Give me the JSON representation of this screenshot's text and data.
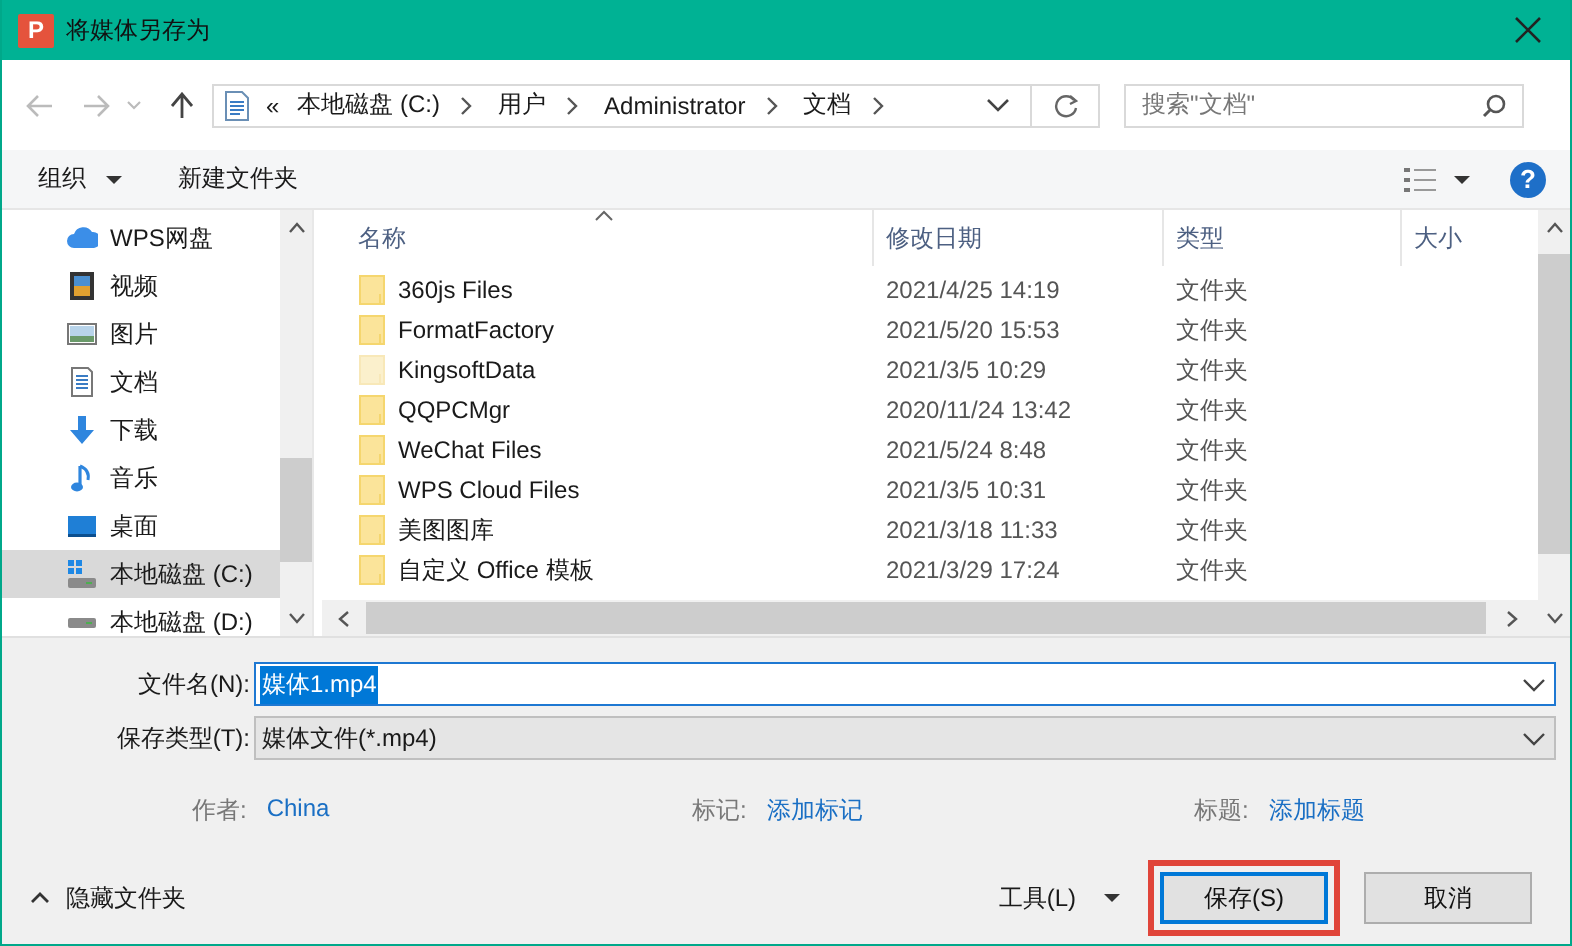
{
  "window": {
    "title": "将媒体另存为",
    "app_badge": "P"
  },
  "address_bar": {
    "prefix": "«",
    "path": [
      "本地磁盘 (C:)",
      "用户",
      "Administrator",
      "文档"
    ]
  },
  "search": {
    "placeholder": "搜索\"文档\""
  },
  "toolbar": {
    "organize": "组织",
    "new_folder": "新建文件夹",
    "help": "?"
  },
  "sidebar": {
    "items": [
      {
        "label": "WPS网盘",
        "kind": "cloud",
        "selected": false
      },
      {
        "label": "视频",
        "kind": "video",
        "selected": false
      },
      {
        "label": "图片",
        "kind": "picture",
        "selected": false
      },
      {
        "label": "文档",
        "kind": "document",
        "selected": false
      },
      {
        "label": "下载",
        "kind": "download",
        "selected": false
      },
      {
        "label": "音乐",
        "kind": "music",
        "selected": false
      },
      {
        "label": "桌面",
        "kind": "desktop",
        "selected": false
      },
      {
        "label": "本地磁盘 (C:)",
        "kind": "system-drive",
        "selected": true
      },
      {
        "label": "本地磁盘 (D:)",
        "kind": "drive",
        "selected": false
      }
    ]
  },
  "file_list": {
    "columns": [
      "名称",
      "修改日期",
      "类型",
      "大小"
    ],
    "rows": [
      {
        "name": "360js Files",
        "modified": "2021/4/25 14:19",
        "type": "文件夹",
        "hidden": false
      },
      {
        "name": "FormatFactory",
        "modified": "2021/5/20 15:53",
        "type": "文件夹",
        "hidden": false
      },
      {
        "name": "KingsoftData",
        "modified": "2021/3/5 10:29",
        "type": "文件夹",
        "hidden": true
      },
      {
        "name": "QQPCMgr",
        "modified": "2020/11/24 13:42",
        "type": "文件夹",
        "hidden": false
      },
      {
        "name": "WeChat Files",
        "modified": "2021/5/24 8:48",
        "type": "文件夹",
        "hidden": false
      },
      {
        "name": "WPS Cloud Files",
        "modified": "2021/3/5 10:31",
        "type": "文件夹",
        "hidden": false
      },
      {
        "name": "美图图库",
        "modified": "2021/3/18 11:33",
        "type": "文件夹",
        "hidden": false
      },
      {
        "name": "自定义 Office 模板",
        "modified": "2021/3/29 17:24",
        "type": "文件夹",
        "hidden": false
      }
    ]
  },
  "form": {
    "file_name": {
      "label": "文件名(N):",
      "value": "媒体1.mp4",
      "text_selected": true
    },
    "file_type": {
      "label": "保存类型(T):",
      "value": "媒体文件(*.mp4)"
    },
    "properties": [
      {
        "label": "作者:",
        "value": "China"
      },
      {
        "label": "标记:",
        "value": "添加标记"
      },
      {
        "label": "标题:",
        "value": "添加标题"
      }
    ]
  },
  "footer": {
    "hide_folders": "隐藏文件夹",
    "tools": "工具(L)",
    "buttons": [
      {
        "label": "保存(S)",
        "highlighted": true
      },
      {
        "label": "取消",
        "highlighted": false
      }
    ]
  }
}
